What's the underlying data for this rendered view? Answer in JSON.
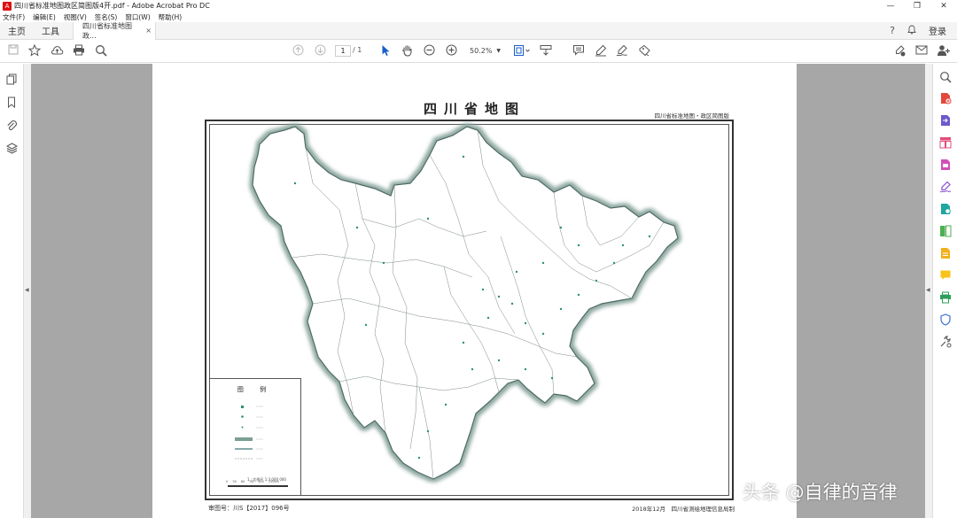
{
  "window": {
    "title": "四川省标准地图政区简图版4开.pdf - Adobe Acrobat Pro DC",
    "minimize": "—",
    "maximize": "❐",
    "close": "✕"
  },
  "menu": {
    "items": [
      "文件(F)",
      "编辑(E)",
      "视图(V)",
      "签名(S)",
      "窗口(W)",
      "帮助(H)"
    ]
  },
  "tabs": {
    "home": "主页",
    "tools": "工具",
    "document": "四川省标准地图政...",
    "document_close": "×",
    "help_icon": "?",
    "bell_icon": "🔔",
    "login": "登录"
  },
  "toolbar": {
    "page_current": "1",
    "page_total": "/ 1",
    "zoom": "50.2%",
    "zoom_caret": "▼"
  },
  "map": {
    "title": "四川省地图",
    "subtitle": "四川省标准地图・政区简图版",
    "approval": "审图号：川S【2017】096号",
    "publisher": "2018年12月　四川省测绘地理信息局制",
    "legend": {
      "title": "图 例",
      "scale": "1 : 比例尺 1:3 000 000",
      "scale_ticks": "0 30 60 90 120 150km"
    }
  },
  "watermark": "头条 @自律的音律"
}
